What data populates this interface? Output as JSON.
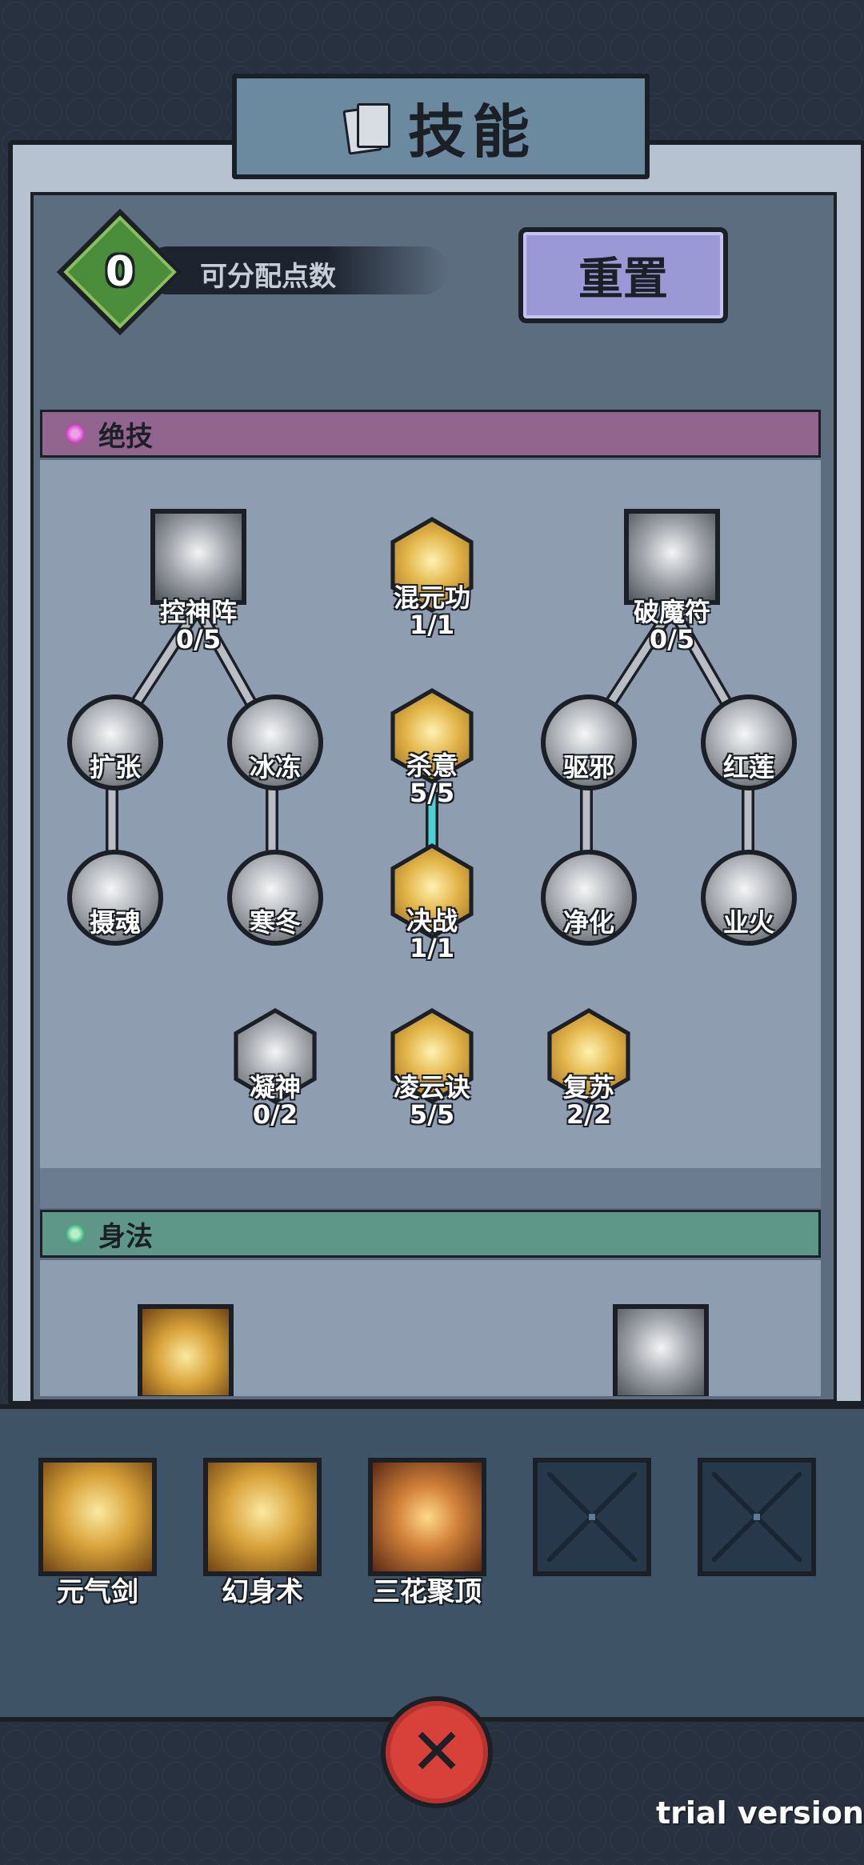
{
  "header": {
    "title": "技能"
  },
  "points": {
    "value": "0",
    "label": "可分配点数"
  },
  "reset": {
    "label": "重置"
  },
  "sections": {
    "ultimate": {
      "title": "绝技"
    },
    "movement": {
      "title": "身法"
    }
  },
  "skills": {
    "kongshenzhen": {
      "name": "控神阵",
      "level": "0/5"
    },
    "hunyuangong": {
      "name": "混元功",
      "level": "1/1"
    },
    "pomofu": {
      "name": "破魔符",
      "level": "0/5"
    },
    "kuozhang": {
      "name": "扩张"
    },
    "bingdong": {
      "name": "冰冻"
    },
    "shayi": {
      "name": "杀意",
      "level": "5/5"
    },
    "quxie": {
      "name": "驱邪"
    },
    "honglian": {
      "name": "红莲"
    },
    "shehun": {
      "name": "摄魂"
    },
    "handong": {
      "name": "寒冬"
    },
    "juezhan": {
      "name": "决战",
      "level": "1/1"
    },
    "jinghua": {
      "name": "净化"
    },
    "yehuo": {
      "name": "业火"
    },
    "ningshen": {
      "name": "凝神",
      "level": "0/2"
    },
    "lingyunjue": {
      "name": "凌云诀",
      "level": "5/5"
    },
    "fusu": {
      "name": "复苏",
      "level": "2/2"
    }
  },
  "equipped": [
    {
      "name": "元气剑"
    },
    {
      "name": "幻身术"
    },
    {
      "name": "三花聚顶"
    },
    {
      "name": ""
    },
    {
      "name": ""
    }
  ],
  "footer": {
    "watermark": "trial version"
  },
  "colors": {
    "ultimate_header": "#91658d",
    "movement_header": "#5e9788",
    "reset_button": "#9b98d6",
    "points_diamond": "#4a8d3b",
    "close_button": "#d8413a"
  }
}
